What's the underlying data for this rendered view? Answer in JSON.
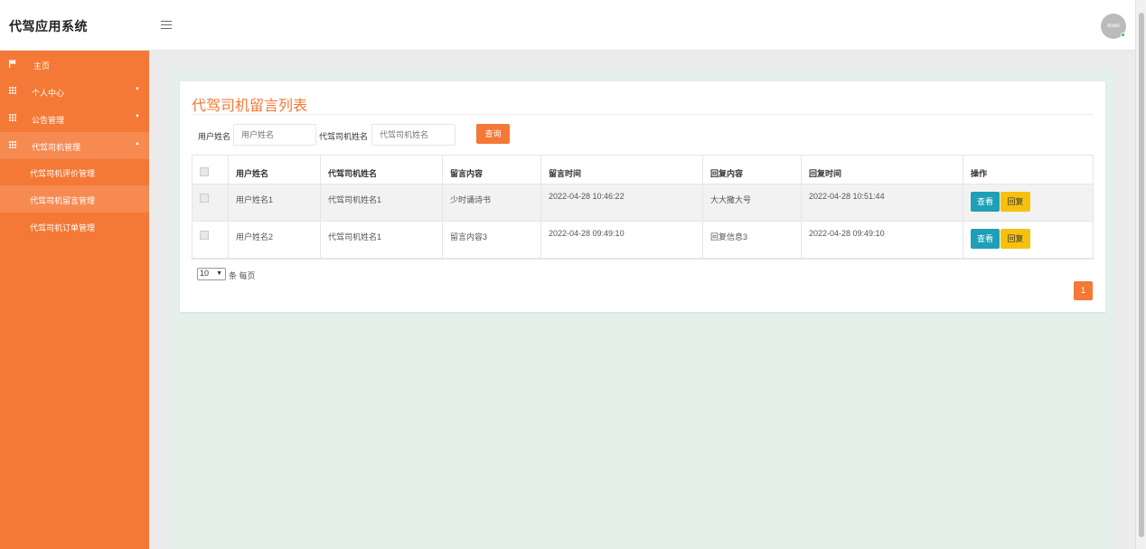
{
  "app": {
    "title": "代驾应用系统"
  },
  "header": {
    "menu_icon": "hamburger-icon",
    "avatar_text": "80x80"
  },
  "sidebar": {
    "items": [
      {
        "label": "主页",
        "icon": "flag-icon"
      },
      {
        "label": "个人中心",
        "icon": "grid-icon"
      },
      {
        "label": "公告管理",
        "icon": "grid-icon"
      },
      {
        "label": "代驾司机管理",
        "icon": "grid-icon"
      }
    ],
    "subitems": [
      {
        "label": "代驾司机评价管理"
      },
      {
        "label": "代驾司机留言管理"
      },
      {
        "label": "代驾司机订单管理"
      }
    ]
  },
  "main": {
    "title": "代驾司机留言列表",
    "search": {
      "user_label": "用户姓名",
      "user_placeholder": "用户姓名",
      "driver_label": "代驾司机姓名",
      "driver_placeholder": "代驾司机姓名",
      "button": "查询"
    },
    "table": {
      "headers": [
        "用户姓名",
        "代驾司机姓名",
        "留言内容",
        "留言时间",
        "回复内容",
        "回复时间",
        "操作"
      ],
      "rows": [
        {
          "user": "用户姓名1",
          "driver": "代驾司机姓名1",
          "message": "少时诵诗书",
          "msg_time": "2022-04-28 10:46:22",
          "reply": "大大撒大号",
          "reply_time": "2022-04-28 10:51:44"
        },
        {
          "user": "用户姓名2",
          "driver": "代驾司机姓名1",
          "message": "留言内容3",
          "msg_time": "2022-04-28 09:49:10",
          "reply": "回复信息3",
          "reply_time": "2022-04-28 09:49:10"
        }
      ],
      "view_label": "查看",
      "reply_label": "回复"
    },
    "pagination": {
      "page_size": "10",
      "page_size_suffix": "条 每页",
      "current_page": "1"
    }
  },
  "colors": {
    "accent": "#f47836",
    "view_button": "#1e9fb7",
    "reply_button": "#f6c10e",
    "panel_bg": "#e4f1eb"
  }
}
